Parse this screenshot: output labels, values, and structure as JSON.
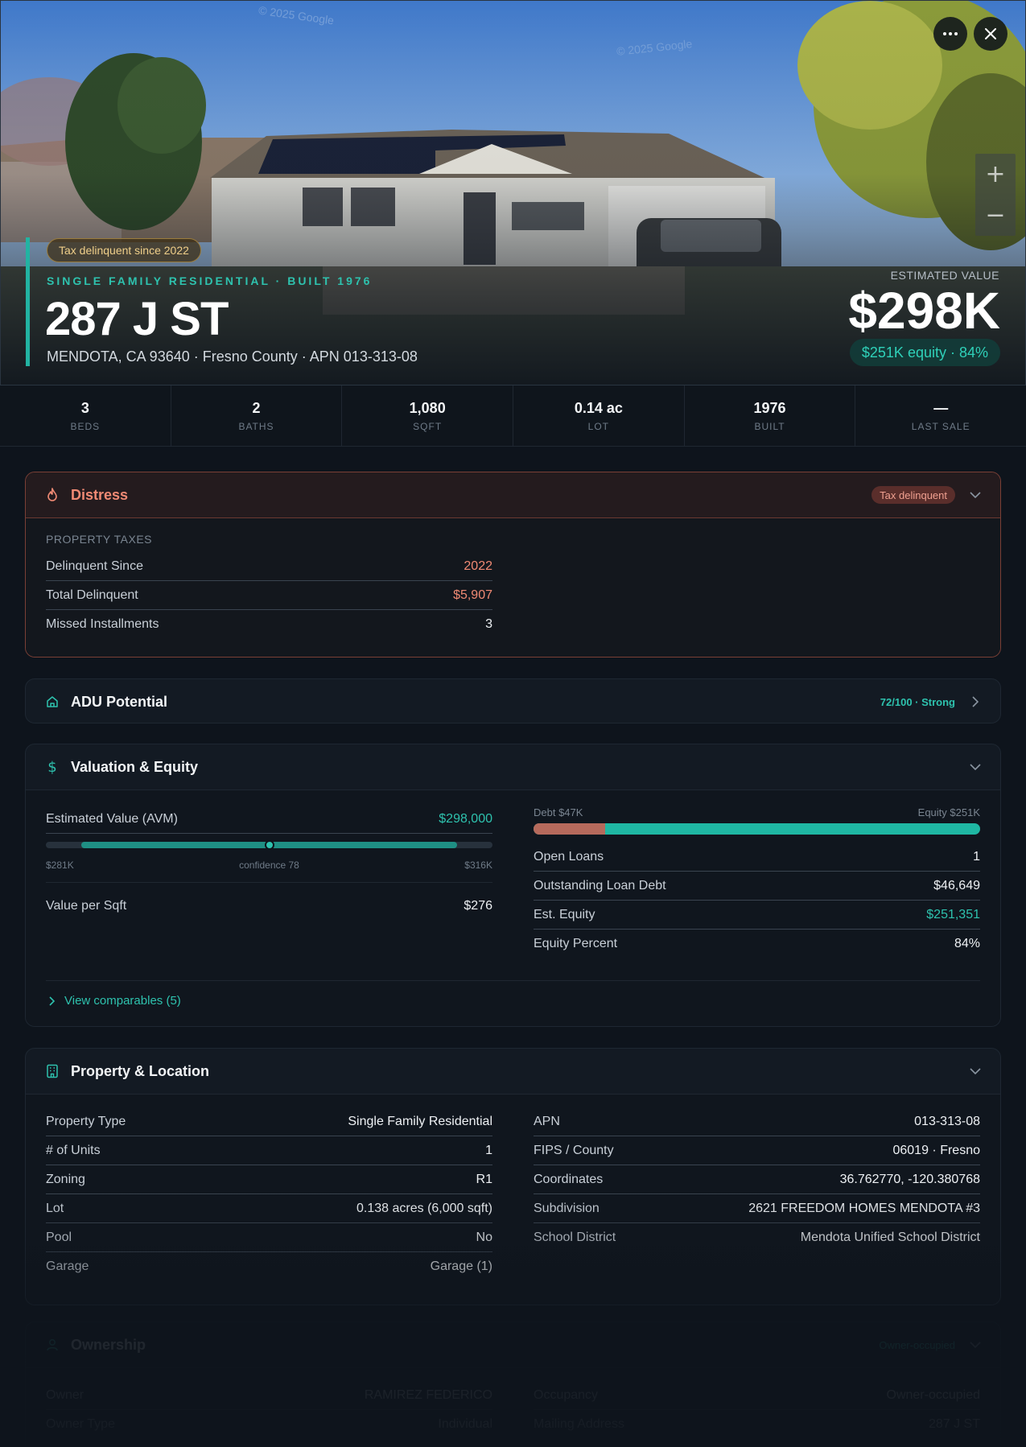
{
  "hero": {
    "tag": "Tax delinquent since 2022",
    "eyebrow": "SINGLE FAMILY RESIDENTIAL · BUILT 1976",
    "address": "287 J ST",
    "subtitle": "MENDOTA, CA 93640 · Fresno County · APN 013-313-08",
    "estimate_label": "ESTIMATED VALUE",
    "estimate_value": "$298K",
    "equity_pill": "$251K equity · 84%",
    "watermark1": "© 2025 Google",
    "watermark2": "© 2025 Google"
  },
  "stats": [
    {
      "value": "3",
      "label": "BEDS"
    },
    {
      "value": "2",
      "label": "BATHS"
    },
    {
      "value": "1,080",
      "label": "SQFT"
    },
    {
      "value": "0.14 ac",
      "label": "LOT"
    },
    {
      "value": "1976",
      "label": "BUILT"
    },
    {
      "value": "—",
      "label": "LAST SALE"
    }
  ],
  "distress": {
    "title": "Distress",
    "badge": "Tax delinquent",
    "section": "PROPERTY TAXES",
    "rows": [
      {
        "k": "Delinquent Since",
        "v": "2022"
      },
      {
        "k": "Total Delinquent",
        "v": "$5,907"
      },
      {
        "k": "Missed Installments",
        "v": "3"
      }
    ]
  },
  "adu": {
    "title": "ADU Potential",
    "score": "72/100 · Strong"
  },
  "valuation": {
    "title": "Valuation & Equity",
    "avm_label": "Estimated Value (AVM)",
    "avm_value": "$298,000",
    "range_low": "$281K",
    "range_high": "$316K",
    "confidence": "confidence 78",
    "range_position": 0.5,
    "sqft_label": "Value per Sqft",
    "sqft_value": "$276",
    "debt_label": "Debt $47K",
    "equity_label": "Equity $251K",
    "debt_fraction": 0.16,
    "rows": [
      {
        "k": "Open Loans",
        "v": "1"
      },
      {
        "k": "Outstanding Loan Debt",
        "v": "$46,649"
      },
      {
        "k": "Est. Equity",
        "v": "$251,351"
      },
      {
        "k": "Equity Percent",
        "v": "84%"
      }
    ],
    "comps": "View comparables (5)"
  },
  "property": {
    "title": "Property & Location",
    "left": [
      {
        "k": "Property Type",
        "v": "Single Family Residential"
      },
      {
        "k": "# of Units",
        "v": "1"
      },
      {
        "k": "Zoning",
        "v": "R1"
      },
      {
        "k": "Lot",
        "v": "0.138 acres (6,000 sqft)"
      },
      {
        "k": "Pool",
        "v": "No"
      },
      {
        "k": "Garage",
        "v": "Garage (1)"
      }
    ],
    "right": [
      {
        "k": "APN",
        "v": "013-313-08"
      },
      {
        "k": "FIPS / County",
        "v": "06019 · Fresno"
      },
      {
        "k": "Coordinates",
        "v": "36.762770, -120.380768"
      },
      {
        "k": "Subdivision",
        "v": "2621 FREEDOM HOMES MENDOTA #3"
      },
      {
        "k": "School District",
        "v": "Mendota Unified School District"
      }
    ]
  },
  "ownership": {
    "title": "Ownership",
    "badge": "Owner-occupied",
    "left": [
      {
        "k": "Owner",
        "v": "RAMIREZ FEDERICO"
      },
      {
        "k": "Owner Type",
        "v": "Individual"
      }
    ],
    "right": [
      {
        "k": "Occupancy",
        "v": "Owner-occupied"
      },
      {
        "k": "Mailing Address",
        "v": "287 J ST"
      }
    ]
  },
  "icons": {
    "more": "more-icon",
    "close": "close-icon",
    "zoom_in": "plus-icon",
    "zoom_out": "minus-icon",
    "distress": "flame-icon",
    "adu": "house-icon",
    "valuation": "dollar-icon",
    "property": "building-icon",
    "ownership": "user-icon"
  },
  "colors": {
    "accent": "#2ec2ae",
    "danger": "#f08a74",
    "background": "#0e141c"
  }
}
